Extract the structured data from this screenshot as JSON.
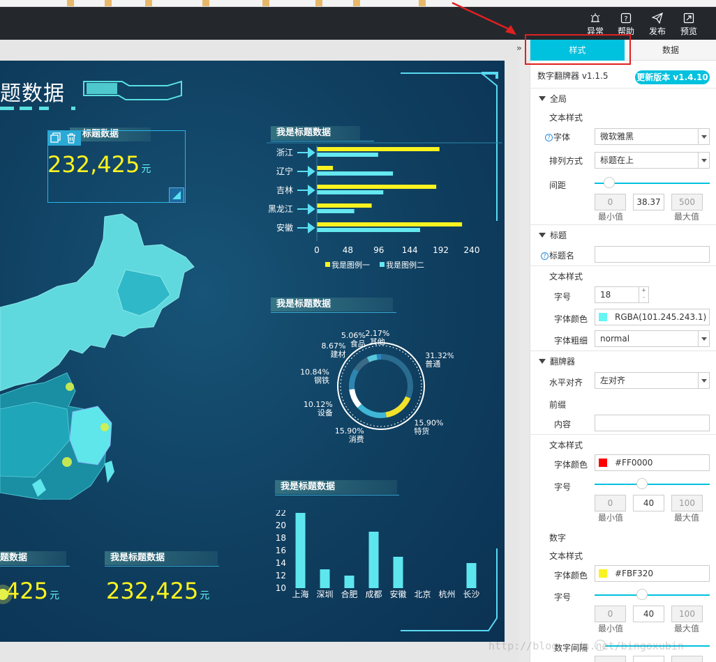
{
  "toolbar": {
    "items": [
      {
        "label": "异常",
        "icon": "alarm-icon"
      },
      {
        "label": "帮助",
        "icon": "help-icon"
      },
      {
        "label": "发布",
        "icon": "send-icon"
      },
      {
        "label": "预览",
        "icon": "expand-icon"
      }
    ]
  },
  "canvas": {
    "header_title": "题数据",
    "widgets": {
      "flip_top_title": "标题数据",
      "flip_top_value": "232,425",
      "unit": "元",
      "flip_bottom_left_title": "题数据",
      "flip_bottom_left_value": "425",
      "flip_bottom_right_title": "我是标题数据",
      "flip_bottom_right_value": "232,425",
      "bar_chart_title": "我是标题数据",
      "ring_chart_title": "我是标题数据",
      "column_chart_title": "我是标题数据"
    }
  },
  "chart_data": [
    {
      "type": "bar",
      "orientation": "horizontal",
      "title": "我是标题数据",
      "categories": [
        "浙江",
        "辽宁",
        "吉林",
        "黑龙江",
        "安徽"
      ],
      "series": [
        {
          "name": "我是图例一",
          "color": "#fbf320",
          "values": [
            190,
            25,
            185,
            85,
            225
          ]
        },
        {
          "name": "我是图例二",
          "color": "#65e8f0",
          "values": [
            95,
            118,
            103,
            58,
            160
          ]
        }
      ],
      "xticks": [
        "0",
        "48",
        "96",
        "144",
        "192",
        "240"
      ],
      "xlim": [
        0,
        240
      ],
      "legend": "bottom"
    },
    {
      "type": "pie",
      "title": "我是标题数据",
      "slices": [
        {
          "label": "普通",
          "pct": "31.32%",
          "value": 31.32
        },
        {
          "label": "特货",
          "pct": "15.90%",
          "value": 15.9
        },
        {
          "label": "消费",
          "pct": "15.90%",
          "value": 15.9
        },
        {
          "label": "设备",
          "pct": "10.12%",
          "value": 10.12
        },
        {
          "label": "钢铁",
          "pct": "10.84%",
          "value": 10.84
        },
        {
          "label": "建材",
          "pct": "8.67%",
          "value": 8.67
        },
        {
          "label": "食品",
          "pct": "5.06%",
          "value": 5.06
        },
        {
          "label": "其他",
          "pct": "2.17%",
          "value": 2.17
        }
      ]
    },
    {
      "type": "bar",
      "title": "我是标题数据",
      "categories": [
        "上海",
        "深圳",
        "合肥",
        "成都",
        "安徽",
        "北京",
        "杭州",
        "长沙"
      ],
      "values": [
        22,
        13,
        12,
        19,
        15,
        9,
        9,
        14
      ],
      "yticks": [
        "10",
        "12",
        "14",
        "16",
        "18",
        "20",
        "22"
      ],
      "ylim": [
        10,
        22
      ],
      "color": "#5ee6ee"
    }
  ],
  "panel": {
    "tabs": {
      "style": "样式",
      "data": "数据"
    },
    "component_name": "数字翻牌器 v1.1.5",
    "update_button": "更新版本 v1.4.10",
    "global": {
      "section": "全局",
      "text_style": "文本样式",
      "font_label": "字体",
      "font_value": "微软雅黑",
      "layout_label": "排列方式",
      "layout_value": "标题在上",
      "spacing_label": "间距",
      "spacing_min": "0",
      "spacing_value": "38.37",
      "spacing_max": "500",
      "min_label": "最小值",
      "max_label": "最大值"
    },
    "title": {
      "section": "标题",
      "name_label": "标题名",
      "name_value": "",
      "text_style": "文本样式",
      "size_label": "字号",
      "size_value": "18",
      "color_label": "字体颜色",
      "color_value": "RGBA(101.245.243.1)",
      "color_hex": "#65f5f3",
      "weight_label": "字体粗细",
      "weight_value": "normal"
    },
    "flipper": {
      "section": "翻牌器",
      "align_label": "水平对齐",
      "align_value": "左对齐",
      "prefix": "前缀",
      "content_label": "内容",
      "content_value": "",
      "text_style": "文本样式",
      "prefix_color_label": "字体颜色",
      "prefix_color_value": "#FF0000",
      "prefix_color_hex": "#ff0000",
      "prefix_size_label": "字号",
      "prefix_size_min": "0",
      "prefix_size_value": "40",
      "prefix_size_max": "100",
      "min_label": "最小值",
      "max_label": "最大值",
      "number": "数字",
      "number_text_style": "文本样式",
      "number_color_label": "字体颜色",
      "number_color_value": "#FBF320",
      "number_color_hex": "#fbf320",
      "number_size_label": "字号",
      "number_size_min": "0",
      "number_size_value": "40",
      "number_size_max": "100",
      "number_min_label": "最小值",
      "number_max_label": "最大值",
      "number_spacing_label": "数字间隔"
    }
  },
  "watermark": "http://blog.csdn.net/bingoxubin"
}
